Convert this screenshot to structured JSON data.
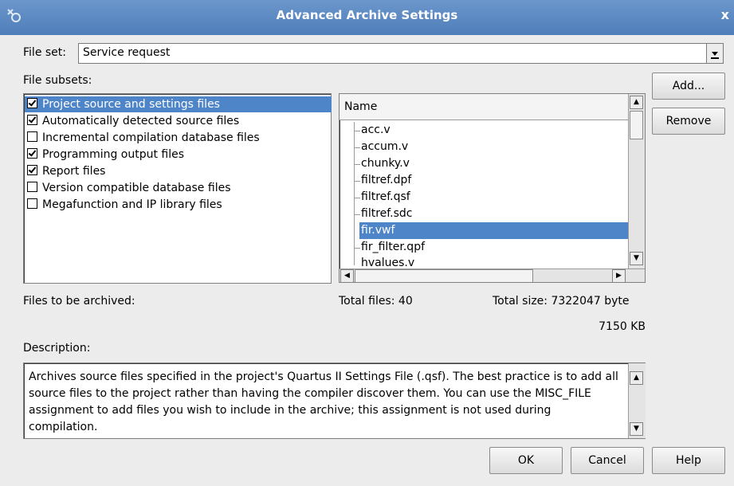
{
  "window": {
    "title": "Advanced Archive Settings",
    "close_glyph": "x"
  },
  "file_set": {
    "label": "File set:",
    "value": "Service request"
  },
  "file_subsets": {
    "label": "File subsets:",
    "items": [
      {
        "label": "Project source and settings files",
        "checked": true,
        "selected": true
      },
      {
        "label": "Automatically detected source files",
        "checked": true,
        "selected": false
      },
      {
        "label": "Incremental compilation database files",
        "checked": false,
        "selected": false
      },
      {
        "label": "Programming output files",
        "checked": true,
        "selected": false
      },
      {
        "label": "Report files",
        "checked": true,
        "selected": false
      },
      {
        "label": "Version compatible database files",
        "checked": false,
        "selected": false
      },
      {
        "label": "Megafunction and IP library files",
        "checked": false,
        "selected": false
      }
    ]
  },
  "file_list": {
    "column_header": "Name",
    "files": [
      {
        "name": "acc.v",
        "selected": false
      },
      {
        "name": "accum.v",
        "selected": false
      },
      {
        "name": "chunky.v",
        "selected": false
      },
      {
        "name": "filtref.dpf",
        "selected": false
      },
      {
        "name": "filtref.qsf",
        "selected": false
      },
      {
        "name": "filtref.sdc",
        "selected": false
      },
      {
        "name": "fir.vwf",
        "selected": true
      },
      {
        "name": "fir_filter.qpf",
        "selected": false
      },
      {
        "name": "hvalues.v",
        "selected": false
      }
    ]
  },
  "buttons": {
    "add": "Add...",
    "remove": "Remove",
    "ok": "OK",
    "cancel": "Cancel",
    "help": "Help"
  },
  "stats": {
    "files_to_be_archived": "Files to be archived:",
    "total_files": "Total files: 40",
    "total_size": "Total size: 7322047 byte",
    "size_kb": "7150 KB"
  },
  "description": {
    "label": "Description:",
    "text": "Archives source files specified in the project's Quartus II Settings File (.qsf). The best practice is to add all source files to the project rather than having the compiler discover them. You can use the MISC_FILE assignment to add files you wish to include in the archive; this assignment is not used during compilation."
  },
  "colors": {
    "titlebar": "#5a88c2",
    "selection": "#4e84c8",
    "background": "#ececec"
  }
}
